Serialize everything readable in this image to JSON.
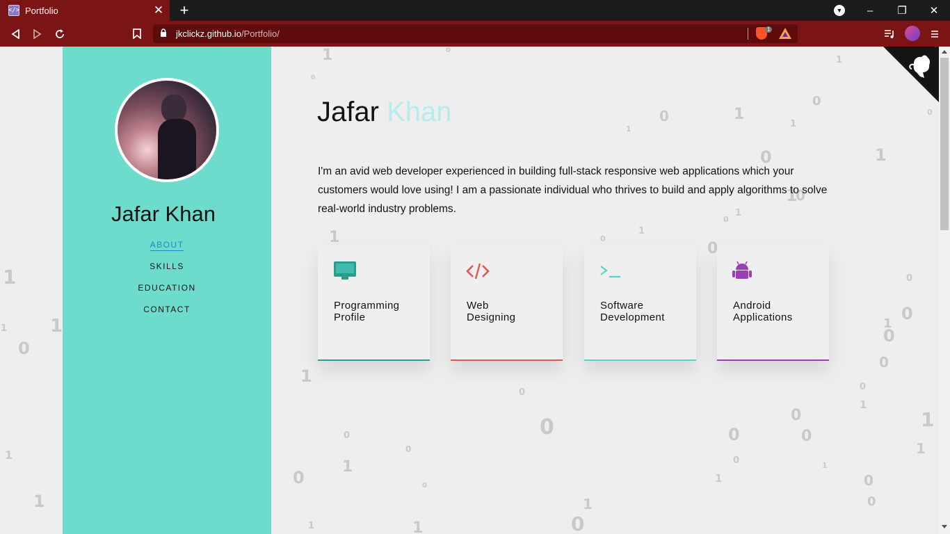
{
  "browser": {
    "tab_title": "Portfolio",
    "tab_favicon": "</>",
    "url_host": "jkclickz.github.io",
    "url_path": "/Portfolio/",
    "shield_count": "1",
    "tab_close_icon": "close-icon",
    "new_tab_icon": "plus-icon"
  },
  "sidebar": {
    "name": "Jafar Khan",
    "nav": [
      {
        "label": "ABOUT",
        "active": true
      },
      {
        "label": "SKILLS",
        "active": false
      },
      {
        "label": "EDUCATION",
        "active": false
      },
      {
        "label": "CONTACT",
        "active": false
      }
    ],
    "bg_color": "#6edccc"
  },
  "main": {
    "title_first": "Jafar",
    "title_last": "Khan",
    "bio": "I'm an avid web developer experienced in building full-stack responsive web applications which your customers would love using! I am a passionate individual who thrives to build and apply algorithms to solve real-world industry problems.",
    "cards": [
      {
        "label_line1": "Programming",
        "label_line2": "Profile",
        "icon": "monitor-icon",
        "color": "#2a9d8f"
      },
      {
        "label_line1": "Web",
        "label_line2": "Designing",
        "icon": "code-icon",
        "color": "#e05555"
      },
      {
        "label_line1": "Software",
        "label_line2": "Development",
        "icon": "terminal-icon",
        "color": "#56d4c8"
      },
      {
        "label_line1": "Android",
        "label_line2": "Applications",
        "icon": "android-icon",
        "color": "#9b3fb5"
      }
    ]
  },
  "background_digits": [
    "1",
    "0",
    "0",
    "1",
    "0",
    "1",
    "0",
    "1",
    "1",
    "0",
    "0",
    "1",
    "1",
    "1",
    "0",
    "0",
    "1",
    "1",
    "0",
    "1",
    "0",
    "1",
    "0",
    "1",
    "1",
    "0",
    "0",
    "1",
    "0",
    "0",
    "0",
    "1",
    "0",
    "0",
    "1",
    "0",
    "0",
    "1",
    "0",
    "1",
    "0",
    "0",
    "0",
    "1",
    "0",
    "1",
    "0",
    "1",
    "0",
    "1",
    "0"
  ]
}
